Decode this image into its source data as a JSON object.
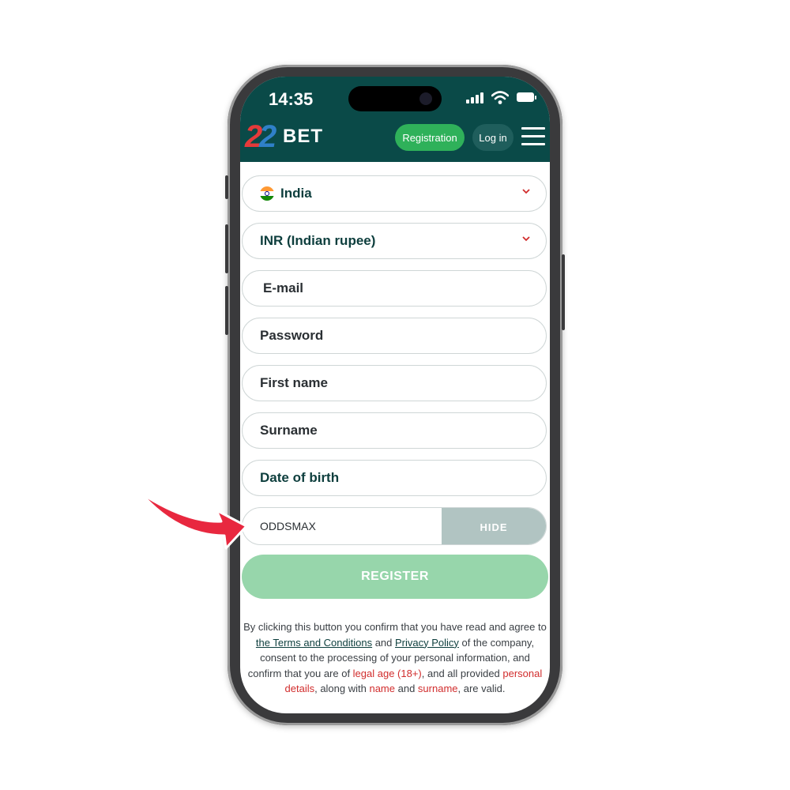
{
  "status_bar": {
    "time": "14:35"
  },
  "header": {
    "logo_digits": [
      "2",
      "2"
    ],
    "logo_word": "BET",
    "registration_label": "Registration",
    "login_label": "Log in"
  },
  "form": {
    "country": {
      "value": "India",
      "flag": "india-flag-icon"
    },
    "currency": {
      "value": "INR (Indian rupee)"
    },
    "email": {
      "placeholder": "E-mail"
    },
    "password": {
      "placeholder": "Password"
    },
    "first_name": {
      "placeholder": "First name"
    },
    "surname": {
      "placeholder": "Surname"
    },
    "date_of_birth": {
      "placeholder": "Date of birth"
    },
    "promo": {
      "value": "ODDSMAX",
      "hide_label": "HIDE"
    },
    "register_label": "REGISTER"
  },
  "legal": {
    "part1": "By clicking this button you confirm that you have read and agree to ",
    "terms_link": "the Terms and Conditions",
    "part2": " and ",
    "privacy_link": "Privacy Policy",
    "part3": " of the company, consent to the processing of your personal information, and confirm that you are of ",
    "legal_age": "legal age (18+)",
    "part4": ", and all provided ",
    "personal_details": "personal details",
    "part5": ", along with ",
    "name": "name",
    "part6": " and ",
    "surname": "surname",
    "part7": ", are valid."
  },
  "colors": {
    "header_bg": "#0a4a48",
    "registration_btn": "#2fb15a",
    "register_btn_disabled": "#97d6ab",
    "accent_red": "#d12d2d",
    "arrow": "#e8283f"
  }
}
